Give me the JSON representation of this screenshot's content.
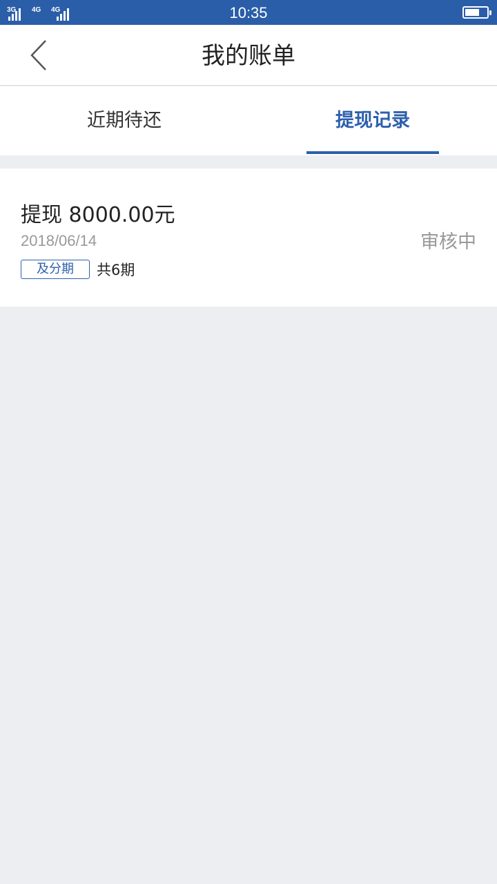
{
  "status_bar": {
    "signal_1": "3G",
    "signal_2": "4G",
    "signal_3": "4G",
    "time": "10:35",
    "battery_icon": "battery-icon"
  },
  "nav": {
    "back_icon": "chevron-left-icon",
    "title": "我的账单"
  },
  "tabs": [
    {
      "label": "近期待还",
      "active": false
    },
    {
      "label": "提现记录",
      "active": true
    }
  ],
  "records": [
    {
      "title": "提现 8000.00元",
      "date": "2018/06/14",
      "tag": "及分期",
      "periods": "共6期",
      "status": "审核中"
    }
  ],
  "colors": {
    "status_bar": "#2b5ea8",
    "accent": "#2d5fab",
    "background": "#edeef2"
  }
}
